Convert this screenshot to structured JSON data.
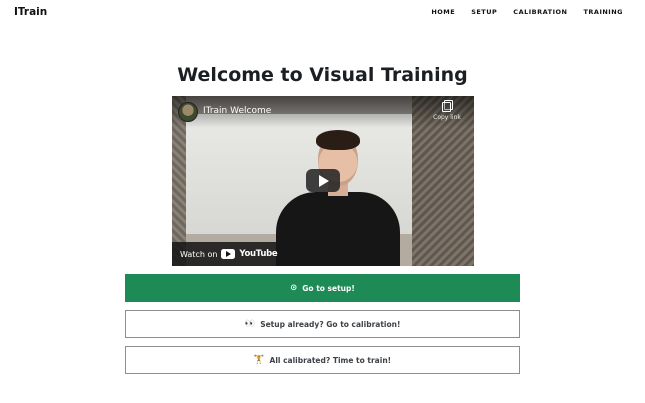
{
  "navbar": {
    "brand": "ITrain",
    "links": [
      "HOME",
      "SETUP",
      "CALIBRATION",
      "TRAINING"
    ]
  },
  "page": {
    "title": "Welcome to Visual Training"
  },
  "video": {
    "title": "ITrain Welcome",
    "copy_label": "Copy link",
    "watch_on": "Watch on",
    "platform": "YouTube"
  },
  "buttons": {
    "setup": {
      "icon": "⊙",
      "label": "Go to setup!"
    },
    "calibration": {
      "icon": "👀",
      "label": "Setup already? Go to calibration!"
    },
    "training": {
      "icon": "🏋",
      "label": "All calibrated? Time to train!"
    }
  },
  "colors": {
    "primary": "#1e8a56",
    "outline_border": "#8a8f94"
  }
}
